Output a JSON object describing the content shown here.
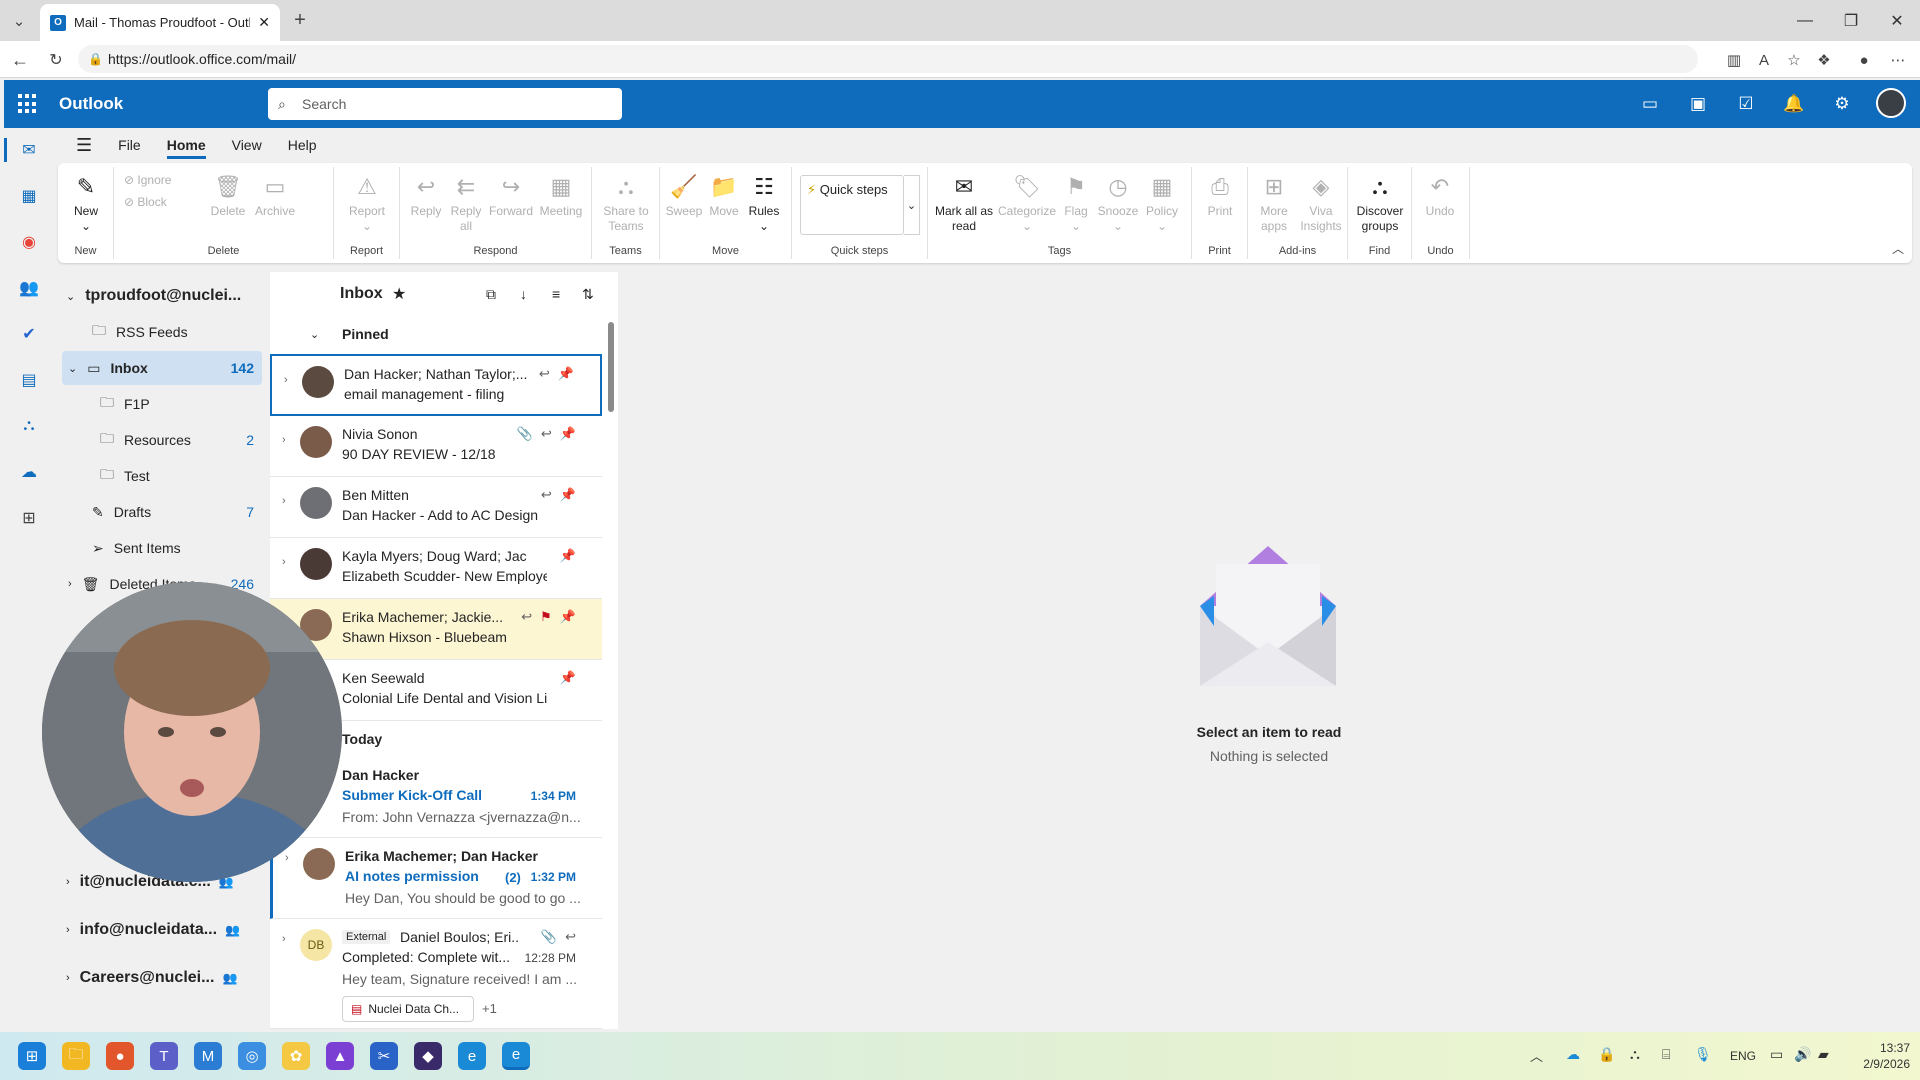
{
  "browser": {
    "tab_title": "Mail - Thomas Proudfoot - Outlook",
    "url": "https://outlook.office.com/mail/"
  },
  "header": {
    "app_name": "Outlook",
    "search_placeholder": "Search"
  },
  "menu": {
    "items": [
      "File",
      "Home",
      "View",
      "Help"
    ],
    "active": "Home"
  },
  "ribbon": {
    "groups": [
      {
        "label": "New",
        "buttons": [
          "New"
        ]
      },
      {
        "label": "Delete",
        "buttons": [
          "Ignore",
          "Block",
          "Delete",
          "Archive"
        ]
      },
      {
        "label": "Report",
        "buttons": [
          "Report"
        ]
      },
      {
        "label": "Respond",
        "buttons": [
          "Reply",
          "Reply all",
          "Forward",
          "Meeting"
        ]
      },
      {
        "label": "Teams",
        "buttons": [
          "Share to Teams"
        ]
      },
      {
        "label": "Move",
        "buttons": [
          "Sweep",
          "Move",
          "Rules"
        ]
      },
      {
        "label": "Quick steps",
        "buttons": [
          "Quick steps"
        ]
      },
      {
        "label": "Tags",
        "buttons": [
          "Mark all as read",
          "Categorize",
          "Flag",
          "Snooze",
          "Policy"
        ]
      },
      {
        "label": "Print",
        "buttons": [
          "Print"
        ]
      },
      {
        "label": "Add-ins",
        "buttons": [
          "More apps",
          "Viva Insights"
        ]
      },
      {
        "label": "Find",
        "buttons": [
          "Discover groups"
        ]
      },
      {
        "label": "Undo",
        "buttons": [
          "Undo"
        ]
      }
    ]
  },
  "folders": {
    "account": "tproudfoot@nuclei...",
    "items": [
      {
        "name": "RSS Feeds",
        "count": ""
      },
      {
        "name": "Inbox",
        "count": "142"
      },
      {
        "name": "F1P",
        "count": ""
      },
      {
        "name": "Resources",
        "count": "2"
      },
      {
        "name": "Test",
        "count": ""
      },
      {
        "name": "Drafts",
        "count": "7"
      },
      {
        "name": "Sent Items",
        "count": ""
      },
      {
        "name": "Deleted Items",
        "count": "246"
      }
    ],
    "shared": [
      "it@nucleidata.c...",
      "info@nucleidata...",
      "Careers@nuclei..."
    ]
  },
  "list": {
    "title": "Inbox",
    "pinned_label": "Pinned",
    "today_label": "Today",
    "pinned": [
      {
        "sender": "Dan Hacker; Nathan Taylor;...",
        "subject": "email management - filing"
      },
      {
        "sender": "Nivia Sonon",
        "subject": "90 DAY REVIEW - 12/18"
      },
      {
        "sender": "Ben Mitten",
        "subject": "Dan Hacker - Add to AC Design"
      },
      {
        "sender": "Kayla Myers; Doug Ward; Jacki...",
        "subject": "Elizabeth Scudder- New Employee"
      },
      {
        "sender": "Erika Machemer; Jackie...",
        "subject": "Shawn Hixson - Bluebeam"
      },
      {
        "sender": "Ken Seewald",
        "subject": "Colonial Life Dental and Vision Life"
      }
    ],
    "today": [
      {
        "sender": "Dan Hacker",
        "subject": "Submer Kick-Off Call",
        "time": "1:34 PM",
        "preview": "From: John Vernazza <jvernazza@n..."
      },
      {
        "sender": "Erika Machemer; Dan Hacker",
        "subject": "AI notes permission",
        "count": "(2)",
        "time": "1:32 PM",
        "preview": "Hey Dan, You should be good to go ..."
      },
      {
        "tag": "External",
        "sender": "Daniel Boulos; Eri...",
        "initials": "DB",
        "subject": "Completed: Complete wit...",
        "time": "12:28 PM",
        "preview": "Hey team, Signature received! I am ...",
        "attachment": "Nuclei Data Ch...",
        "extra": "+1"
      }
    ]
  },
  "reading": {
    "title": "Select an item to read",
    "subtitle": "Nothing is selected"
  },
  "taskbar": {
    "lang": "ENG",
    "time": "13:37",
    "date": "2/9/2026"
  }
}
